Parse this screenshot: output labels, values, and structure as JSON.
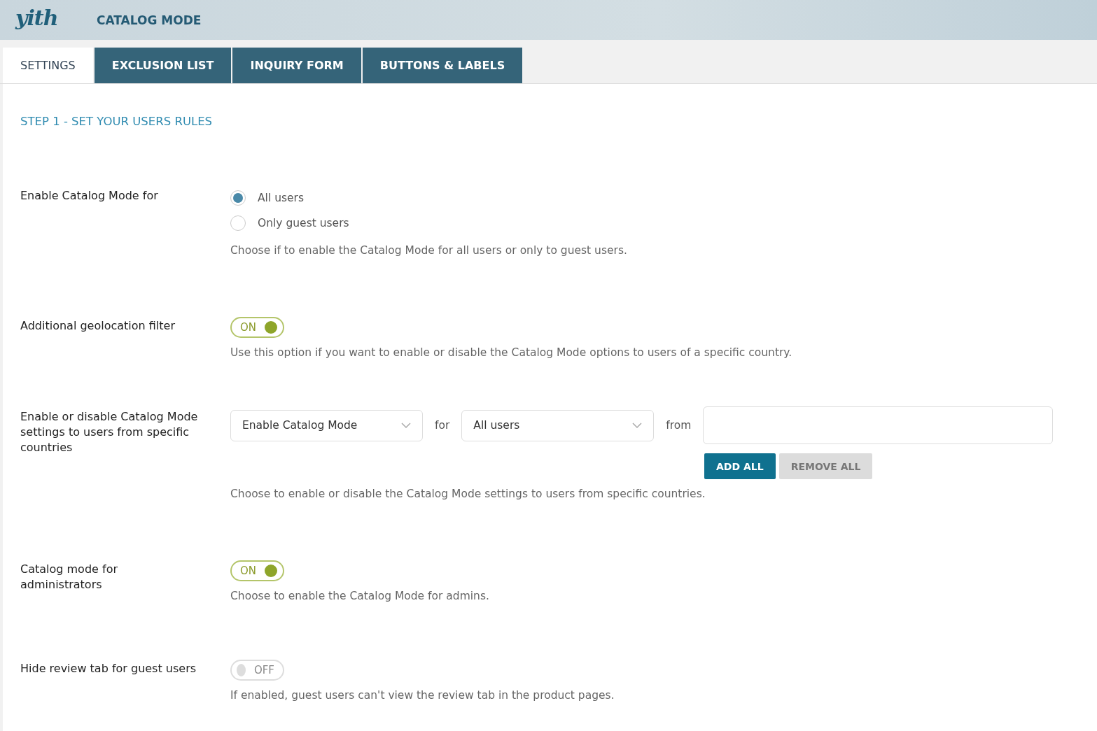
{
  "header": {
    "logo": "yith",
    "title": "CATALOG MODE"
  },
  "tabs": [
    {
      "label": "SETTINGS",
      "selected": true
    },
    {
      "label": "EXCLUSION LIST",
      "selected": false
    },
    {
      "label": "INQUIRY FORM",
      "selected": false
    },
    {
      "label": "BUTTONS & LABELS",
      "selected": false
    }
  ],
  "section_title": "STEP 1 - SET YOUR USERS RULES",
  "settings": [
    {
      "kind": "radio",
      "label": "Enable Catalog Mode for",
      "options": [
        {
          "label": "All users",
          "selected": true
        },
        {
          "label": "Only guest users",
          "selected": false
        }
      ],
      "description": "Choose if to enable the Catalog Mode for all users or only to guest users."
    },
    {
      "kind": "toggle",
      "label": "Additional geolocation filter",
      "on": true,
      "toggle_text": "ON",
      "description": "Use this option if you want to enable or disable the Catalog Mode options to users of a specific country."
    },
    {
      "kind": "geo",
      "label": "Enable or disable Catalog Mode settings to users from specific countries",
      "mode_select": "Enable Catalog Mode",
      "for_text": "for",
      "users_select": "All users",
      "from_text": "from",
      "buttons": [
        "ADD ALL",
        "REMOVE ALL"
      ],
      "description": "Choose to enable or disable the Catalog Mode settings to users from specific countries."
    },
    {
      "kind": "toggle",
      "label": "Catalog mode for administrators",
      "on": true,
      "toggle_text": "ON",
      "description": "Choose to enable the Catalog Mode for admins."
    },
    {
      "kind": "toggle",
      "label": "Hide review tab for guest users",
      "on": false,
      "toggle_text": "OFF",
      "description": "If enabled, guest users can't view the review tab in the product pages."
    }
  ]
}
